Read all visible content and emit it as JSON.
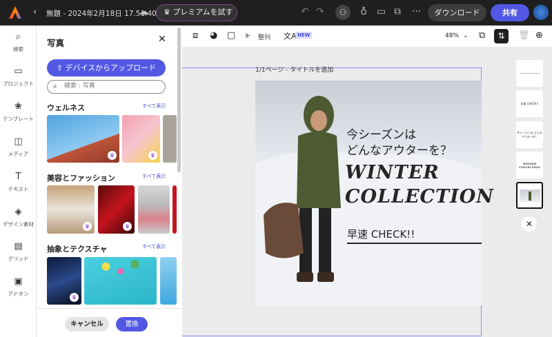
{
  "topbar": {
    "title": "無題 - 2024年2月18日 17.51.40",
    "premium": "プレミアムを試す",
    "download": "ダウンロード",
    "share": "共有"
  },
  "rail": [
    {
      "label": "検索",
      "icon": "⌕"
    },
    {
      "label": "プロジェクト",
      "icon": "▭"
    },
    {
      "label": "テンプレート",
      "icon": "❀"
    },
    {
      "label": "メディア",
      "icon": "◫"
    },
    {
      "label": "テキスト",
      "icon": "T"
    },
    {
      "label": "デザイン素材",
      "icon": "◈"
    },
    {
      "label": "グリッド",
      "icon": "▤"
    },
    {
      "label": "アドオン",
      "icon": "▣"
    }
  ],
  "panel": {
    "title": "写真",
    "upload": "デバイスからアップロード",
    "search_placeholder": "検索 : 写真",
    "sections": [
      {
        "title": "ウェルネス",
        "see_all": "すべて表示"
      },
      {
        "title": "美容とファッション",
        "see_all": "すべて表示"
      },
      {
        "title": "抽象とテクスチャ",
        "see_all": "すべて表示"
      }
    ],
    "cancel": "キャンセル",
    "replace": "置換"
  },
  "toolbar": {
    "arrange": "整列",
    "new_badge": "NEW",
    "zoom": "48%"
  },
  "canvas": {
    "page_label": "1/1ページ - タイトルを追加",
    "line1": "今シーズンは",
    "line2": "どんなアウターを？",
    "winter": "WINTER",
    "collection": "COLLECTION",
    "check": "早速 CHECK!!"
  },
  "thumbs": {
    "t2": "早速 CHECK!!",
    "t3": "今シーズンは どんなアウターを？",
    "t4": "WINTER COLLECTION"
  }
}
